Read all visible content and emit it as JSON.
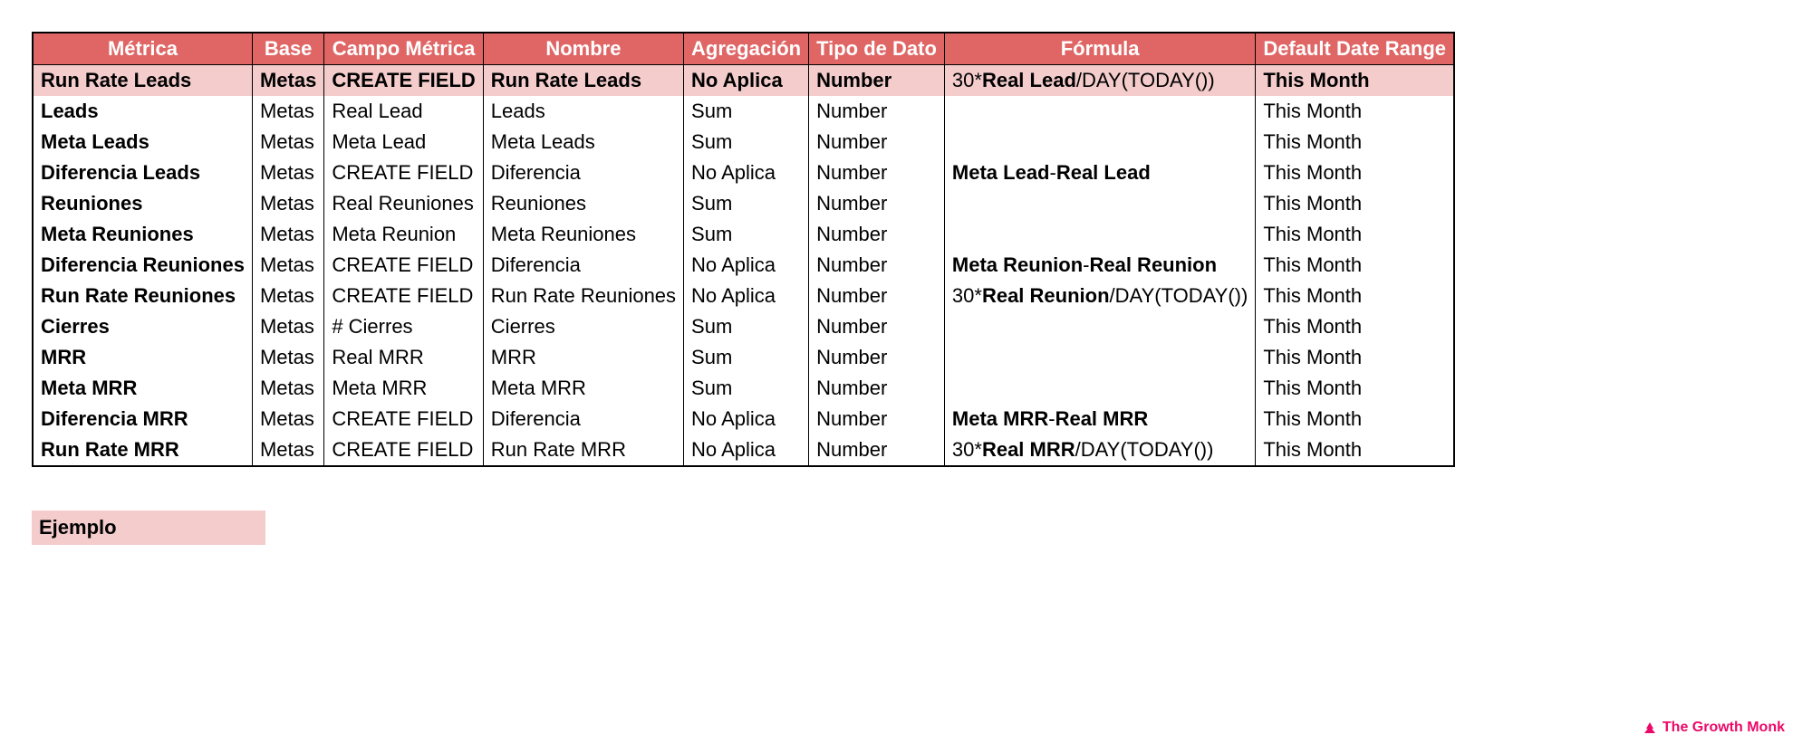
{
  "headers": [
    "Métrica",
    "Base",
    "Campo Métrica",
    "Nombre",
    "Agregación",
    "Tipo de Dato",
    "Fórmula",
    "Default Date Range"
  ],
  "rows": [
    {
      "highlight": true,
      "metrica": "Run Rate Leads",
      "base": "Metas",
      "campo": "CREATE FIELD",
      "nombre": "Run Rate Leads",
      "agregacion": "No Aplica",
      "tipo": "Number",
      "formula": [
        {
          "t": "30*",
          "b": false
        },
        {
          "t": "Real Lead",
          "b": true
        },
        {
          "t": "/DAY(TODAY())",
          "b": false
        }
      ],
      "range": "This Month"
    },
    {
      "highlight": false,
      "metrica": "Leads",
      "base": "Metas",
      "campo": "Real Lead",
      "nombre": "Leads",
      "agregacion": "Sum",
      "tipo": "Number",
      "formula": [],
      "range": "This Month"
    },
    {
      "highlight": false,
      "metrica": "Meta Leads",
      "base": "Metas",
      "campo": "Meta Lead",
      "nombre": "Meta Leads",
      "agregacion": "Sum",
      "tipo": "Number",
      "formula": [],
      "range": "This Month"
    },
    {
      "highlight": false,
      "metrica": "Diferencia Leads",
      "base": "Metas",
      "campo": "CREATE FIELD",
      "nombre": "Diferencia",
      "agregacion": "No Aplica",
      "tipo": "Number",
      "formula": [
        {
          "t": "Meta Lead",
          "b": true
        },
        {
          "t": "-",
          "b": false
        },
        {
          "t": "Real Lead",
          "b": true
        }
      ],
      "range": "This Month"
    },
    {
      "highlight": false,
      "metrica": "Reuniones",
      "base": "Metas",
      "campo": "Real Reuniones",
      "nombre": "Reuniones",
      "agregacion": "Sum",
      "tipo": "Number",
      "formula": [],
      "range": "This Month"
    },
    {
      "highlight": false,
      "metrica": "Meta Reuniones",
      "base": "Metas",
      "campo": "Meta Reunion",
      "nombre": "Meta Reuniones",
      "agregacion": "Sum",
      "tipo": "Number",
      "formula": [],
      "range": "This Month"
    },
    {
      "highlight": false,
      "metrica": "Diferencia Reuniones",
      "base": "Metas",
      "campo": "CREATE FIELD",
      "nombre": "Diferencia",
      "agregacion": "No Aplica",
      "tipo": "Number",
      "formula": [
        {
          "t": "Meta Reunion",
          "b": true
        },
        {
          "t": "-",
          "b": false
        },
        {
          "t": "Real Reunion",
          "b": true
        }
      ],
      "range": "This Month"
    },
    {
      "highlight": false,
      "metrica": "Run Rate Reuniones",
      "base": "Metas",
      "campo": "CREATE FIELD",
      "nombre": "Run Rate Reuniones",
      "agregacion": "No Aplica",
      "tipo": "Number",
      "formula": [
        {
          "t": "30*",
          "b": false
        },
        {
          "t": "Real Reunion",
          "b": true
        },
        {
          "t": "/DAY(TODAY())",
          "b": false
        }
      ],
      "range": "This Month"
    },
    {
      "highlight": false,
      "metrica": "Cierres",
      "base": "Metas",
      "campo": "# Cierres",
      "nombre": "Cierres",
      "agregacion": "Sum",
      "tipo": "Number",
      "formula": [],
      "range": "This Month"
    },
    {
      "highlight": false,
      "metrica": "MRR",
      "base": "Metas",
      "campo": "Real MRR",
      "nombre": "MRR",
      "agregacion": "Sum",
      "tipo": "Number",
      "formula": [],
      "range": "This Month"
    },
    {
      "highlight": false,
      "metrica": "Meta MRR",
      "base": "Metas",
      "campo": "Meta MRR",
      "nombre": "Meta MRR",
      "agregacion": "Sum",
      "tipo": "Number",
      "formula": [],
      "range": "This Month"
    },
    {
      "highlight": false,
      "metrica": "Diferencia MRR",
      "base": "Metas",
      "campo": "CREATE FIELD",
      "nombre": "Diferencia",
      "agregacion": "No Aplica",
      "tipo": "Number",
      "formula": [
        {
          "t": "Meta MRR",
          "b": true
        },
        {
          "t": "-",
          "b": false
        },
        {
          "t": "Real MRR",
          "b": true
        }
      ],
      "range": "This Month"
    },
    {
      "highlight": false,
      "metrica": "Run Rate MRR",
      "base": "Metas",
      "campo": "CREATE FIELD",
      "nombre": "Run Rate MRR",
      "agregacion": "No Aplica",
      "tipo": "Number",
      "formula": [
        {
          "t": "30*",
          "b": false
        },
        {
          "t": "Real MRR",
          "b": true
        },
        {
          "t": "/DAY(TODAY())",
          "b": false
        }
      ],
      "range": "This Month"
    }
  ],
  "legend_label": "Ejemplo",
  "brand_name": "The Growth Monk"
}
